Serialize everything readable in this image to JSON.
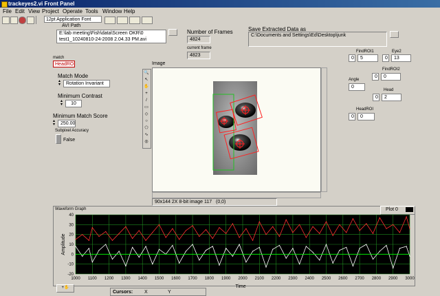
{
  "window": {
    "title": "trackeyes2.vi Front Panel"
  },
  "menu": [
    "File",
    "Edit",
    "View",
    "Project",
    "Operate",
    "Tools",
    "Window",
    "Help"
  ],
  "toolbar": {
    "font": "12pt Application Font"
  },
  "avi_path": {
    "label": "AVI Path",
    "value_line1": "E:\\lab meeting\\Fish\\data\\Screen OKR\\0",
    "value_line2": "test1_10240810-24-2008 2.04.33 PM.avi"
  },
  "number_of_frames": {
    "label": "Number of Frames",
    "value": "4824"
  },
  "current_frame": {
    "label": "current frame",
    "value": "4823"
  },
  "save_data": {
    "label": "Save Extracted Data as",
    "value": "C:\\Documents and Settings\\Ed\\Desktop\\junk"
  },
  "match": {
    "label": "match",
    "value": "HeadROI"
  },
  "match_mode": {
    "label": "Match Mode",
    "value": "Rotation Invariant"
  },
  "min_contrast": {
    "label": "Minimum Contrast",
    "value": "10"
  },
  "min_match": {
    "label": "Minimum Match Score",
    "value": "250.00"
  },
  "subpixel": {
    "label": "Subpixel Accuracy",
    "value": "False"
  },
  "image": {
    "label": "Image",
    "info": "90x144 2X 8-bit image 117",
    "coords": "(0,0)"
  },
  "findroi1": {
    "label": "FindROI1",
    "v1": "0",
    "v2": "5"
  },
  "eye2": {
    "label": "Eye2",
    "v1": "0",
    "v2": "13"
  },
  "angle": {
    "label": "Angle",
    "value": "0"
  },
  "findroi2": {
    "label": "FindROI2",
    "v1": "0",
    "v2": "0"
  },
  "head": {
    "label": "Head",
    "v1": "0",
    "v2": "2"
  },
  "headroi": {
    "label": "HeadROI",
    "v1": "0",
    "v2": "0"
  },
  "graph": {
    "label": "Waveform Graph",
    "plot_legend": "Plot 0",
    "cursors_label": "Cursors:",
    "cursor_x": "X",
    "cursor_y": "Y"
  },
  "colors": {
    "series_red": "#ff3030",
    "series_white": "#ffffff",
    "series_green": "#00ff00",
    "plot_bg": "#000000",
    "grid": "#1e8a1e"
  },
  "chart_data": {
    "type": "line",
    "xlabel": "Time",
    "ylabel": "Amplitude",
    "xlim": [
      1000,
      3000
    ],
    "ylim": [
      -20,
      40
    ],
    "x_ticks": [
      1000,
      1100,
      1200,
      1300,
      1400,
      1500,
      1600,
      1700,
      1800,
      1900,
      2000,
      2100,
      2200,
      2300,
      2400,
      2500,
      2600,
      2700,
      2800,
      2900,
      3000
    ],
    "y_ticks": [
      40,
      30,
      20,
      10,
      0,
      -10,
      -20
    ],
    "grid": true,
    "series": [
      {
        "color": "red",
        "x": [
          1000,
          1040,
          1080,
          1100,
          1140,
          1180,
          1220,
          1260,
          1300,
          1340,
          1380,
          1420,
          1460,
          1500,
          1540,
          1580,
          1620,
          1660,
          1700,
          1740,
          1780,
          1820,
          1860,
          1900,
          1940,
          1980,
          2020,
          2060,
          2100,
          2140,
          2180,
          2220,
          2260,
          2300,
          2340,
          2380,
          2420,
          2460,
          2500,
          2540,
          2580,
          2620,
          2660,
          2700,
          2740,
          2780,
          2820,
          2860,
          2900,
          2940,
          2980,
          3000
        ],
        "y": [
          15,
          20,
          14,
          27,
          18,
          23,
          14,
          21,
          28,
          16,
          24,
          14,
          22,
          30,
          17,
          26,
          15,
          24,
          29,
          18,
          25,
          16,
          27,
          21,
          31,
          17,
          26,
          14,
          33,
          20,
          28,
          18,
          35,
          22,
          30,
          17,
          28,
          21,
          33,
          19,
          30,
          22,
          36,
          24,
          31,
          21,
          37,
          26,
          30,
          22,
          38,
          26
        ]
      },
      {
        "color": "white",
        "x": [
          1000,
          1040,
          1080,
          1100,
          1140,
          1180,
          1220,
          1260,
          1300,
          1340,
          1380,
          1420,
          1460,
          1500,
          1540,
          1580,
          1620,
          1660,
          1700,
          1740,
          1780,
          1820,
          1860,
          1900,
          1940,
          1980,
          2020,
          2060,
          2100,
          2140,
          2180,
          2220,
          2260,
          2300,
          2340,
          2380,
          2420,
          2460,
          2500,
          2540,
          2580,
          2620,
          2660,
          2700,
          2740,
          2780,
          2820,
          2860,
          2900,
          2940,
          2980,
          3000
        ],
        "y": [
          8,
          -2,
          6,
          -8,
          4,
          10,
          -5,
          3,
          -12,
          7,
          -3,
          8,
          -10,
          5,
          0,
          9,
          -9,
          3,
          10,
          -6,
          4,
          8,
          -11,
          6,
          -2,
          10,
          -8,
          3,
          7,
          -13,
          5,
          9,
          -4,
          6,
          -10,
          8,
          2,
          -6,
          10,
          -9,
          4,
          7,
          -12,
          6,
          10,
          -5,
          3,
          9,
          -14,
          6,
          8,
          -2
        ]
      },
      {
        "color": "green",
        "x": [
          1000,
          3000
        ],
        "y": [
          0,
          0
        ]
      }
    ]
  }
}
